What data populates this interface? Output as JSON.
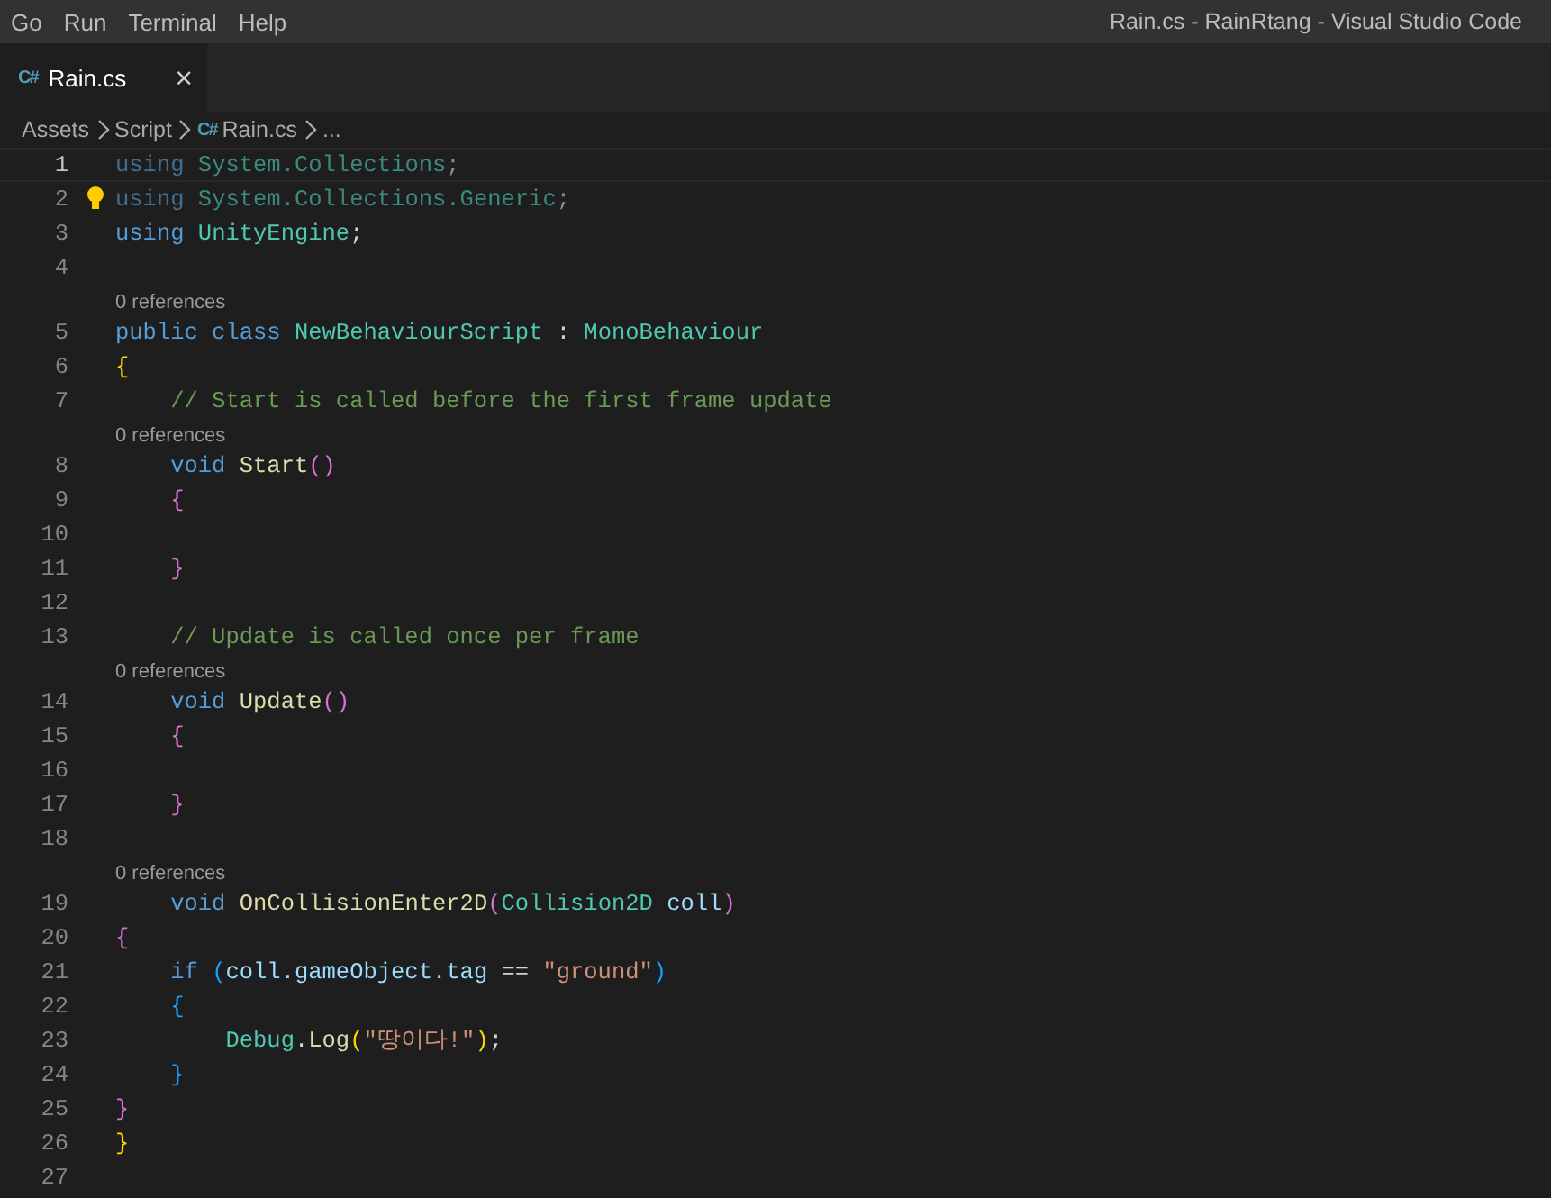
{
  "menu": [
    "Go",
    "Run",
    "Terminal",
    "Help"
  ],
  "window": {
    "title": "Rain.cs - RainRtang - Visual Studio Code"
  },
  "tabs": [
    {
      "label": "Rain.cs",
      "icon": "C#",
      "selected": true,
      "close": "×"
    }
  ],
  "breadcrumbs": [
    {
      "label": "Assets",
      "kind": "folder"
    },
    {
      "label": "Script",
      "kind": "folder"
    },
    {
      "label": "Rain.cs",
      "kind": "file",
      "icon": "C#"
    },
    {
      "label": "...",
      "kind": "more"
    }
  ],
  "lines": [
    {
      "number": "1",
      "current": true,
      "faded": true,
      "tokens": [
        {
          "text": "using ",
          "kind": "keyword"
        },
        {
          "text": "System.Collections",
          "kind": "type"
        },
        {
          "text": ";",
          "kind": "punct"
        }
      ]
    },
    {
      "number": "2",
      "current": false,
      "faded": true,
      "lightbulb": true,
      "tokens": [
        {
          "text": "using ",
          "kind": "keyword"
        },
        {
          "text": "System.Collections.Generic",
          "kind": "type"
        },
        {
          "text": ";",
          "kind": "punct"
        }
      ]
    },
    {
      "number": "3",
      "current": false,
      "tokens": [
        {
          "text": "using ",
          "kind": "keyword"
        },
        {
          "text": "UnityEngine",
          "kind": "type"
        },
        {
          "text": ";",
          "kind": "punct"
        }
      ]
    },
    {
      "number": "4",
      "current": false
    },
    {
      "number": "5",
      "current": false,
      "lens": "0 references",
      "tokens": [
        {
          "text": "public class ",
          "kind": "keyword"
        },
        {
          "text": "NewBehaviourScript",
          "kind": "type"
        },
        {
          "text": " : ",
          "kind": "punct"
        },
        {
          "text": "MonoBehaviour",
          "kind": "type"
        }
      ]
    },
    {
      "number": "6",
      "current": false,
      "tokens": [
        {
          "text": "{",
          "kind": "bracket1"
        }
      ]
    },
    {
      "number": "7",
      "current": false,
      "tokens": [
        {
          "text": "    // Start is called before the first frame update",
          "kind": "comment"
        }
      ]
    },
    {
      "number": "8",
      "current": false,
      "lens": "0 references",
      "tokens": [
        {
          "text": "    void ",
          "kind": "keyword"
        },
        {
          "text": "Start",
          "kind": "function"
        },
        {
          "text": "()",
          "kind": "bracket2"
        }
      ]
    },
    {
      "number": "9",
      "current": false,
      "tokens": [
        {
          "text": "    {",
          "kind": "bracket2"
        }
      ]
    },
    {
      "number": "10",
      "current": false
    },
    {
      "number": "11",
      "current": false,
      "tokens": [
        {
          "text": "    }",
          "kind": "bracket2"
        }
      ]
    },
    {
      "number": "12",
      "current": false
    },
    {
      "number": "13",
      "current": false,
      "tokens": [
        {
          "text": "    // Update is called once per frame",
          "kind": "comment"
        }
      ]
    },
    {
      "number": "14",
      "current": false,
      "lens": "0 references",
      "tokens": [
        {
          "text": "    void ",
          "kind": "keyword"
        },
        {
          "text": "Update",
          "kind": "function"
        },
        {
          "text": "()",
          "kind": "bracket2"
        }
      ]
    },
    {
      "number": "15",
      "current": false,
      "tokens": [
        {
          "text": "    {",
          "kind": "bracket2"
        }
      ]
    },
    {
      "number": "16",
      "current": false
    },
    {
      "number": "17",
      "current": false,
      "tokens": [
        {
          "text": "    }",
          "kind": "bracket2"
        }
      ]
    },
    {
      "number": "18",
      "current": false
    },
    {
      "number": "19",
      "current": false,
      "lens": "0 references",
      "tokens": [
        {
          "text": "    void ",
          "kind": "keyword"
        },
        {
          "text": "OnCollisionEnter2D",
          "kind": "function"
        },
        {
          "text": "(",
          "kind": "bracket2"
        },
        {
          "text": "Collision2D ",
          "kind": "type"
        },
        {
          "text": "coll",
          "kind": "variable"
        },
        {
          "text": ")",
          "kind": "bracket2"
        }
      ]
    },
    {
      "number": "20",
      "current": false,
      "tokens": [
        {
          "text": "{",
          "kind": "bracket2"
        }
      ]
    },
    {
      "number": "21",
      "current": false,
      "tokens": [
        {
          "text": "    if ",
          "kind": "keyword"
        },
        {
          "text": "(",
          "kind": "bracket3"
        },
        {
          "text": "coll.gameObject.tag",
          "kind": "variable"
        },
        {
          "text": " == ",
          "kind": "punct"
        },
        {
          "text": "\"ground\"",
          "kind": "string"
        },
        {
          "text": ")",
          "kind": "bracket3"
        }
      ]
    },
    {
      "number": "22",
      "current": false,
      "tokens": [
        {
          "text": "    {",
          "kind": "bracket3"
        }
      ]
    },
    {
      "number": "23",
      "current": false,
      "tokens": [
        {
          "text": "        Debug",
          "kind": "type"
        },
        {
          "text": ".",
          "kind": "punct"
        },
        {
          "text": "Log",
          "kind": "function"
        },
        {
          "text": "(",
          "kind": "bracket1"
        },
        {
          "text": "\"땅이다!\"",
          "kind": "string"
        },
        {
          "text": ")",
          "kind": "bracket1"
        },
        {
          "text": ";",
          "kind": "punct"
        }
      ]
    },
    {
      "number": "24",
      "current": false,
      "tokens": [
        {
          "text": "    }",
          "kind": "bracket3"
        }
      ]
    },
    {
      "number": "25",
      "current": false,
      "tokens": [
        {
          "text": "}",
          "kind": "bracket2"
        }
      ]
    },
    {
      "number": "26",
      "current": false,
      "tokens": [
        {
          "text": "}",
          "kind": "bracket1"
        }
      ]
    },
    {
      "number": "27",
      "current": false
    }
  ]
}
